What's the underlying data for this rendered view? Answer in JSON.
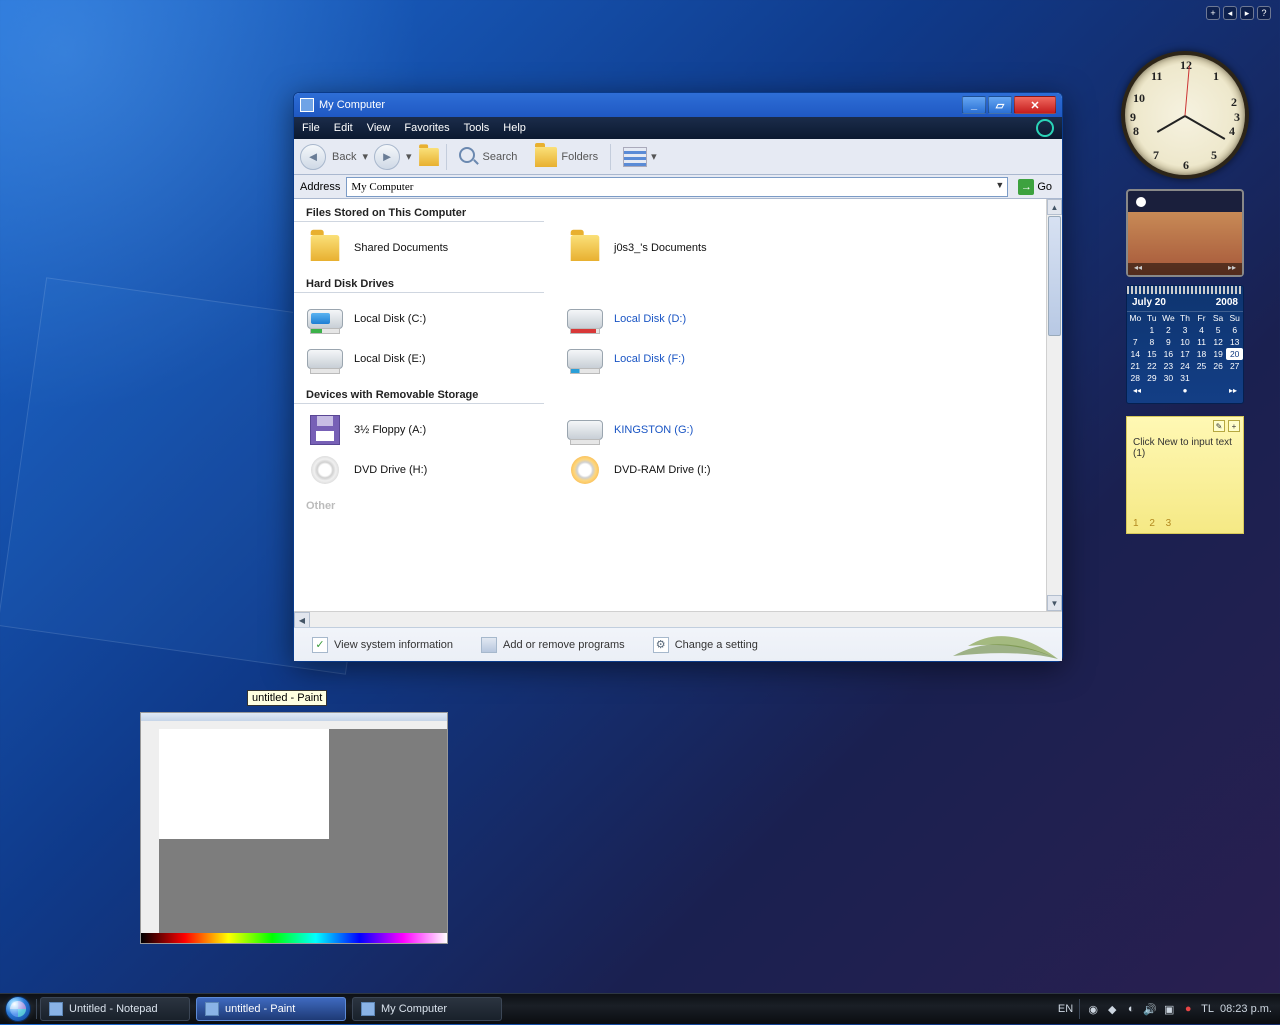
{
  "sidebar_controls": [
    "+",
    "◂",
    "▸",
    "?"
  ],
  "clock": {
    "numbers": [
      "12",
      "1",
      "2",
      "3",
      "4",
      "5",
      "6",
      "7",
      "8",
      "9",
      "10",
      "11"
    ]
  },
  "slideshow": {
    "prev": "◂◂",
    "next": "▸▸"
  },
  "calendar": {
    "month": "July 20",
    "year": "2008",
    "dow": [
      "Mo",
      "Tu",
      "We",
      "Th",
      "Fr",
      "Sa",
      "Su"
    ],
    "rows": [
      [
        "",
        "1",
        "2",
        "3",
        "4",
        "5",
        "6"
      ],
      [
        "7",
        "8",
        "9",
        "10",
        "11",
        "12",
        "13"
      ],
      [
        "14",
        "15",
        "16",
        "17",
        "18",
        "19",
        "20"
      ],
      [
        "21",
        "22",
        "23",
        "24",
        "25",
        "26",
        "27"
      ],
      [
        "28",
        "29",
        "30",
        "31",
        "",
        "",
        ""
      ]
    ],
    "today": "20",
    "foot_left": "◂◂",
    "foot_center": "●",
    "foot_right": "▸▸"
  },
  "sticky": {
    "text": "Click New to input text (1)",
    "pages": "1 2 3",
    "tool1": "✎",
    "tool2": "+"
  },
  "explorer": {
    "title": "My Computer",
    "menu": [
      "File",
      "Edit",
      "View",
      "Favorites",
      "Tools",
      "Help"
    ],
    "toolbar": {
      "back": "Back",
      "dd1": "▾",
      "dd2": "▾",
      "search": "Search",
      "folders": "Folders",
      "views_dd": "▾"
    },
    "address_label": "Address",
    "address_value": "My Computer",
    "address_dd": "▼",
    "go": "Go",
    "sec1": "Files Stored on This Computer",
    "files": [
      {
        "name": "Shared Documents"
      },
      {
        "name": "j0s3_'s Documents"
      }
    ],
    "sec2": "Hard Disk Drives",
    "drives": [
      {
        "name": "Local Disk (C:)",
        "cls": "c"
      },
      {
        "name": "Local Disk (D:)",
        "cls": "d",
        "link": true
      },
      {
        "name": "Local Disk (E:)",
        "cls": "e"
      },
      {
        "name": "Local Disk (F:)",
        "cls": "f",
        "link": true
      }
    ],
    "sec3": "Devices with Removable Storage",
    "removable": [
      {
        "name": "3½ Floppy (A:)",
        "type": "floppy"
      },
      {
        "name": "KINGSTON (G:)",
        "type": "drv",
        "link": true
      },
      {
        "name": "DVD Drive (H:)",
        "type": "dvd"
      },
      {
        "name": "DVD-RAM Drive (I:)",
        "type": "dvdram"
      }
    ],
    "sec4": "Other",
    "tasks": [
      {
        "label": "View system information",
        "icon": "chk"
      },
      {
        "label": "Add or remove programs",
        "icon": "box"
      },
      {
        "label": "Change a setting",
        "icon": "gear"
      }
    ],
    "scroll": {
      "up": "▲",
      "down": "▼",
      "left": "◀"
    }
  },
  "tooltip": "untitled - Paint",
  "taskbar": {
    "items": [
      {
        "label": "Untitled - Notepad",
        "active": false
      },
      {
        "label": "untitled - Paint",
        "active": true
      },
      {
        "label": "My Computer",
        "active": false
      }
    ],
    "lang": "EN",
    "tl": "TL",
    "time": "08:23 p.m."
  }
}
